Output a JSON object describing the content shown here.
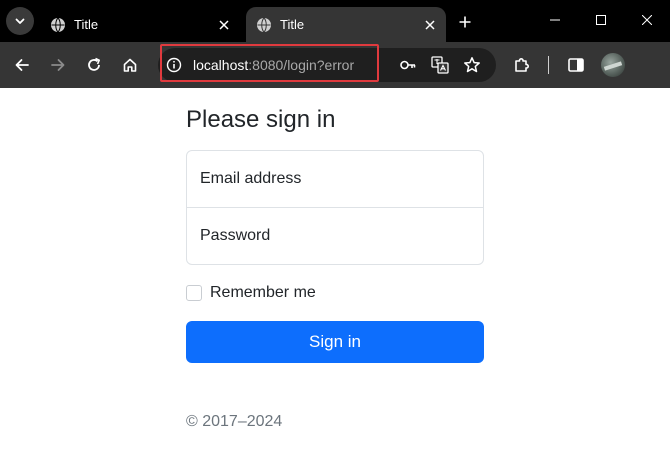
{
  "browser": {
    "tabs": [
      {
        "title": "Title",
        "active": false
      },
      {
        "title": "Title",
        "active": true
      }
    ],
    "address": {
      "host": "localhost",
      "rest": ":8080/login?error"
    },
    "icons": {
      "tab_search": "chevron-down-icon",
      "tab_favicon": "globe-icon",
      "tab_close": "close-icon",
      "new_tab": "plus-icon",
      "back": "arrow-left-icon",
      "forward": "arrow-right-icon",
      "reload": "reload-icon",
      "home": "home-icon",
      "site_info": "info-icon",
      "passwords": "key-icon",
      "translate": "translate-icon",
      "bookmark": "star-icon",
      "extensions": "puzzle-icon",
      "side_panel": "side-panel-icon"
    },
    "colors": {
      "tabstrip": "#000000",
      "toolbar": "#353535",
      "omnibox": "#1f1f1f",
      "highlight": "#e03a3e"
    }
  },
  "page": {
    "heading": "Please sign in",
    "email_placeholder": "Email address",
    "password_placeholder": "Password",
    "remember_label": "Remember me",
    "remember_checked": false,
    "submit_label": "Sign in",
    "footer": "© 2017–2024",
    "colors": {
      "primary": "#0d6efd",
      "muted": "#6c757d",
      "text": "#212529",
      "border": "#dee2e6"
    }
  }
}
